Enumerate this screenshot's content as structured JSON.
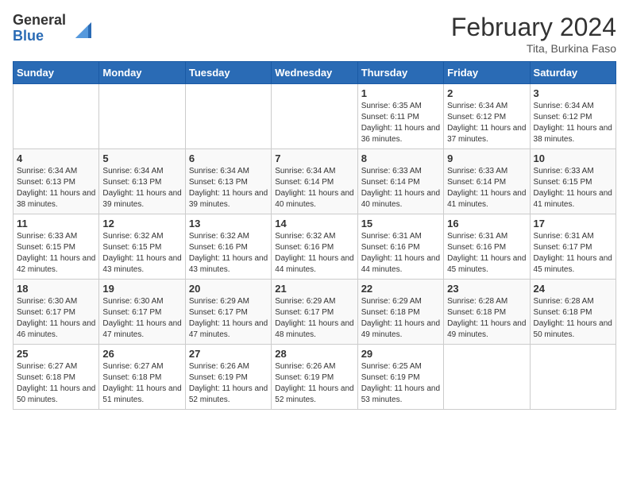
{
  "logo": {
    "general": "General",
    "blue": "Blue"
  },
  "header": {
    "month": "February 2024",
    "location": "Tita, Burkina Faso"
  },
  "weekdays": [
    "Sunday",
    "Monday",
    "Tuesday",
    "Wednesday",
    "Thursday",
    "Friday",
    "Saturday"
  ],
  "weeks": [
    [
      {
        "day": "",
        "info": ""
      },
      {
        "day": "",
        "info": ""
      },
      {
        "day": "",
        "info": ""
      },
      {
        "day": "",
        "info": ""
      },
      {
        "day": "1",
        "info": "Sunrise: 6:35 AM\nSunset: 6:11 PM\nDaylight: 11 hours and 36 minutes."
      },
      {
        "day": "2",
        "info": "Sunrise: 6:34 AM\nSunset: 6:12 PM\nDaylight: 11 hours and 37 minutes."
      },
      {
        "day": "3",
        "info": "Sunrise: 6:34 AM\nSunset: 6:12 PM\nDaylight: 11 hours and 38 minutes."
      }
    ],
    [
      {
        "day": "4",
        "info": "Sunrise: 6:34 AM\nSunset: 6:13 PM\nDaylight: 11 hours and 38 minutes."
      },
      {
        "day": "5",
        "info": "Sunrise: 6:34 AM\nSunset: 6:13 PM\nDaylight: 11 hours and 39 minutes."
      },
      {
        "day": "6",
        "info": "Sunrise: 6:34 AM\nSunset: 6:13 PM\nDaylight: 11 hours and 39 minutes."
      },
      {
        "day": "7",
        "info": "Sunrise: 6:34 AM\nSunset: 6:14 PM\nDaylight: 11 hours and 40 minutes."
      },
      {
        "day": "8",
        "info": "Sunrise: 6:33 AM\nSunset: 6:14 PM\nDaylight: 11 hours and 40 minutes."
      },
      {
        "day": "9",
        "info": "Sunrise: 6:33 AM\nSunset: 6:14 PM\nDaylight: 11 hours and 41 minutes."
      },
      {
        "day": "10",
        "info": "Sunrise: 6:33 AM\nSunset: 6:15 PM\nDaylight: 11 hours and 41 minutes."
      }
    ],
    [
      {
        "day": "11",
        "info": "Sunrise: 6:33 AM\nSunset: 6:15 PM\nDaylight: 11 hours and 42 minutes."
      },
      {
        "day": "12",
        "info": "Sunrise: 6:32 AM\nSunset: 6:15 PM\nDaylight: 11 hours and 43 minutes."
      },
      {
        "day": "13",
        "info": "Sunrise: 6:32 AM\nSunset: 6:16 PM\nDaylight: 11 hours and 43 minutes."
      },
      {
        "day": "14",
        "info": "Sunrise: 6:32 AM\nSunset: 6:16 PM\nDaylight: 11 hours and 44 minutes."
      },
      {
        "day": "15",
        "info": "Sunrise: 6:31 AM\nSunset: 6:16 PM\nDaylight: 11 hours and 44 minutes."
      },
      {
        "day": "16",
        "info": "Sunrise: 6:31 AM\nSunset: 6:16 PM\nDaylight: 11 hours and 45 minutes."
      },
      {
        "day": "17",
        "info": "Sunrise: 6:31 AM\nSunset: 6:17 PM\nDaylight: 11 hours and 45 minutes."
      }
    ],
    [
      {
        "day": "18",
        "info": "Sunrise: 6:30 AM\nSunset: 6:17 PM\nDaylight: 11 hours and 46 minutes."
      },
      {
        "day": "19",
        "info": "Sunrise: 6:30 AM\nSunset: 6:17 PM\nDaylight: 11 hours and 47 minutes."
      },
      {
        "day": "20",
        "info": "Sunrise: 6:29 AM\nSunset: 6:17 PM\nDaylight: 11 hours and 47 minutes."
      },
      {
        "day": "21",
        "info": "Sunrise: 6:29 AM\nSunset: 6:17 PM\nDaylight: 11 hours and 48 minutes."
      },
      {
        "day": "22",
        "info": "Sunrise: 6:29 AM\nSunset: 6:18 PM\nDaylight: 11 hours and 49 minutes."
      },
      {
        "day": "23",
        "info": "Sunrise: 6:28 AM\nSunset: 6:18 PM\nDaylight: 11 hours and 49 minutes."
      },
      {
        "day": "24",
        "info": "Sunrise: 6:28 AM\nSunset: 6:18 PM\nDaylight: 11 hours and 50 minutes."
      }
    ],
    [
      {
        "day": "25",
        "info": "Sunrise: 6:27 AM\nSunset: 6:18 PM\nDaylight: 11 hours and 50 minutes."
      },
      {
        "day": "26",
        "info": "Sunrise: 6:27 AM\nSunset: 6:18 PM\nDaylight: 11 hours and 51 minutes."
      },
      {
        "day": "27",
        "info": "Sunrise: 6:26 AM\nSunset: 6:19 PM\nDaylight: 11 hours and 52 minutes."
      },
      {
        "day": "28",
        "info": "Sunrise: 6:26 AM\nSunset: 6:19 PM\nDaylight: 11 hours and 52 minutes."
      },
      {
        "day": "29",
        "info": "Sunrise: 6:25 AM\nSunset: 6:19 PM\nDaylight: 11 hours and 53 minutes."
      },
      {
        "day": "",
        "info": ""
      },
      {
        "day": "",
        "info": ""
      }
    ]
  ]
}
